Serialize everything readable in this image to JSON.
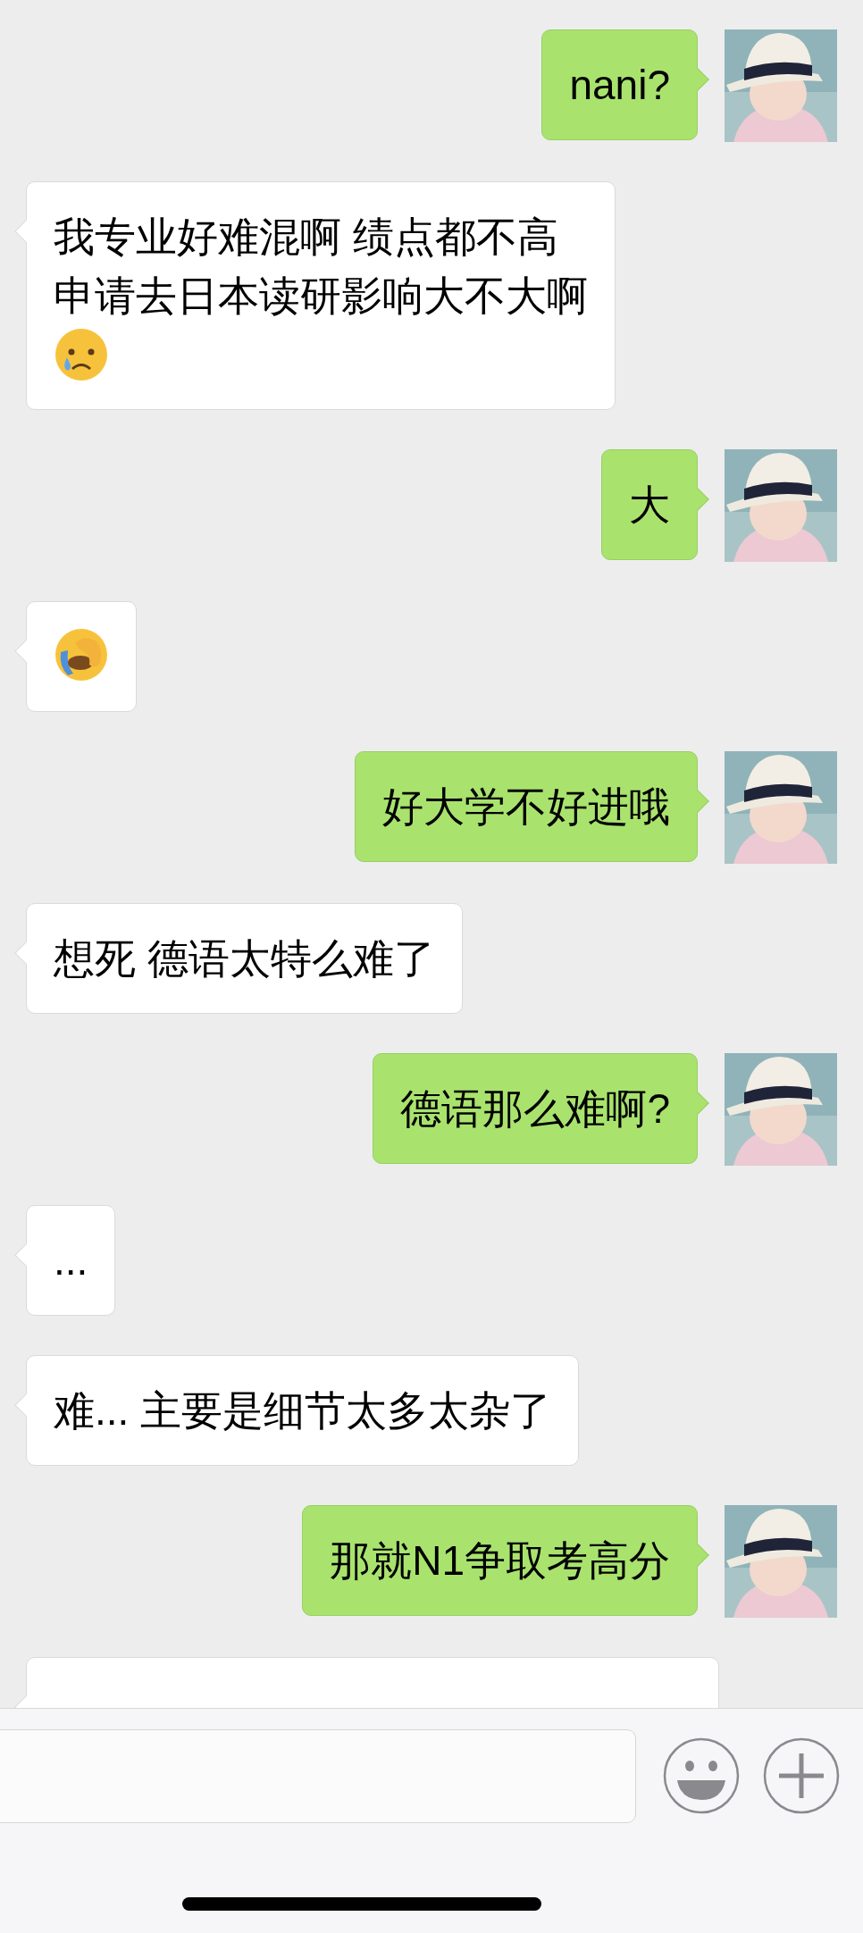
{
  "messages": [
    {
      "sent": true,
      "lines": [
        "nani?"
      ]
    },
    {
      "sent": false,
      "lines": [
        "我专业好难混啊 绩点都不高",
        "申请去日本读研影响大不大啊"
      ],
      "emoji": {
        "kind": "crying"
      }
    },
    {
      "sent": true,
      "lines": [
        "大"
      ]
    },
    {
      "sent": false,
      "emoji": {
        "kind": "facepalm"
      }
    },
    {
      "sent": true,
      "lines": [
        "好大学不好进哦"
      ]
    },
    {
      "sent": false,
      "lines": [
        "想死 德语太特么难了"
      ]
    },
    {
      "sent": true,
      "lines": [
        "德语那么难啊?"
      ]
    },
    {
      "sent": false,
      "lines": [
        "..."
      ]
    },
    {
      "sent": false,
      "lines": [
        "难... 主要是细节太多太杂了"
      ]
    },
    {
      "sent": true,
      "lines": [
        "那就N1争取考高分"
      ]
    },
    {
      "sent": false
    }
  ]
}
